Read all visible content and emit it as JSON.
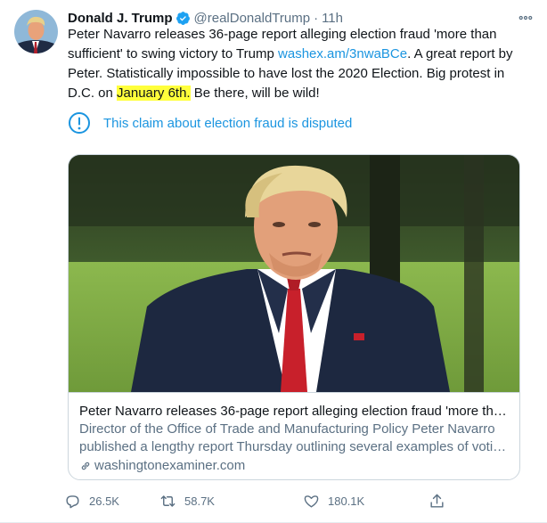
{
  "tweet": {
    "author_name": "Donald J. Trump",
    "handle": "@realDonaldTrump",
    "separator": "·",
    "time": "11h",
    "text_before_link": "Peter Navarro releases 36-page report alleging election fraud 'more than sufficient' to swing victory to Trump ",
    "link_text": "washex.am/3nwaBCe",
    "text_mid": ". A great report by Peter. Statistically impossible to have lost the 2020 Election. Big protest in D.C. on ",
    "highlight_text": "January 6th.",
    "text_after": " Be there, will be wild!",
    "highlight_color": "#ffff3b"
  },
  "notice": {
    "icon": "info-circle-icon",
    "text": "This claim about election fraud is disputed"
  },
  "card": {
    "title": "Peter Navarro releases 36-page report alleging election fraud 'more tha...",
    "description_line1": "Director of the Office of Trade and Manufacturing Policy Peter Navarro",
    "description_line2": "published a lengthy report Thursday outlining several examples of votin...",
    "domain": "washingtonexaminer.com"
  },
  "actions": {
    "reply_count": "26.5K",
    "retweet_count": "58.7K",
    "like_count": "180.1K"
  },
  "colors": {
    "accent": "#1b95e0",
    "muted": "#5b7083",
    "verified": "#1da1f2"
  }
}
